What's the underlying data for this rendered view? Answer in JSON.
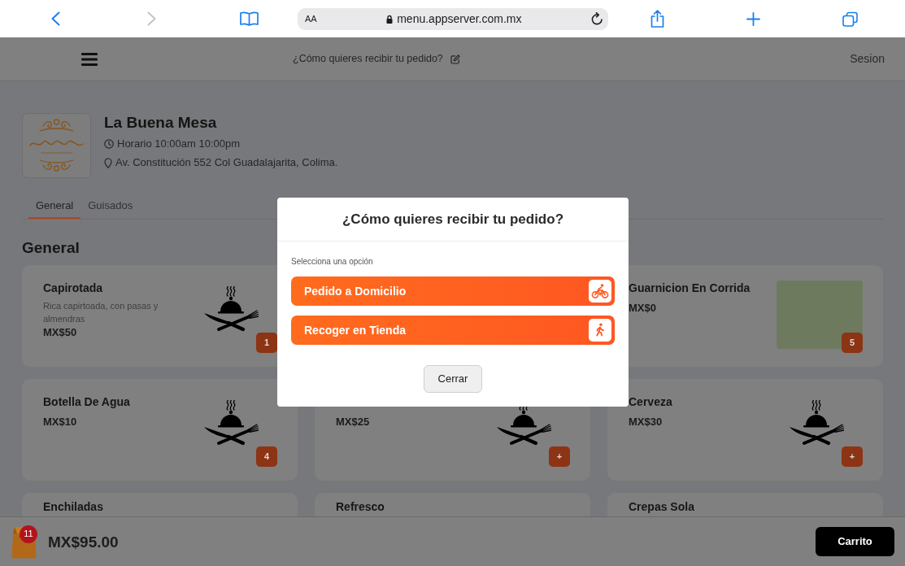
{
  "browser": {
    "back_disabled": false,
    "forward_disabled": true,
    "text_size_label": "AA",
    "url": "menu.appserver.com.mx"
  },
  "header": {
    "delivery_prompt": "¿Cómo quieres recibir tu pedido?",
    "session_link": "Sesion"
  },
  "restaurant": {
    "name": "La Buena Mesa",
    "hours": "Horario 10:00am 10:00pm",
    "address": "Av. Constitución 552 Col Guadalajarita, Colima."
  },
  "tabs": [
    {
      "label": "General",
      "selected": true
    },
    {
      "label": "Guisados",
      "selected": false
    }
  ],
  "section_title": "General",
  "product_columns": [
    [
      {
        "name": "Capirotada",
        "description": "Rica capirtoada, con pasas y almendras",
        "price": "MX$50",
        "image": {
          "kind": "cutlery"
        },
        "button_label": "1"
      },
      {
        "name": "Botella De Agua",
        "price": "MX$10",
        "image": {
          "kind": "cutlery"
        },
        "button_label": "4"
      },
      {
        "name": "Enchiladas"
      }
    ],
    [
      {
        "price": "MX$25",
        "image": {
          "kind": "cutlery"
        },
        "button_label": "+"
      },
      {
        "name": "Refresco"
      }
    ],
    [
      {
        "name": "Guarnicion En Corrida",
        "price": "MX$0",
        "image": {
          "kind": "photo"
        },
        "button_label": "5"
      },
      {
        "name": "Cerveza",
        "price": "MX$30",
        "image": {
          "kind": "cutlery"
        },
        "button_label": "+"
      },
      {
        "name": "Crepas Sola"
      }
    ]
  ],
  "modal": {
    "title": "¿Cómo quieres recibir tu pedido?",
    "prompt": "Selecciona una opción",
    "options": [
      {
        "label": "Pedido a Domicilio",
        "kind": "delivery"
      },
      {
        "label": "Recoger en Tienda",
        "kind": "pickup"
      }
    ],
    "close_button": "Cerrar"
  },
  "cart_bar": {
    "item_count": "11",
    "total": "MX$95.00",
    "cart_button": "Carrito"
  }
}
